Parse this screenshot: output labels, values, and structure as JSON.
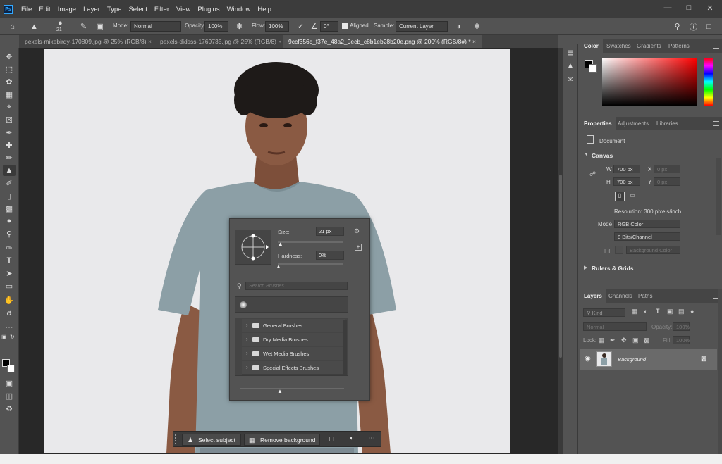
{
  "app": {
    "logo": "Ps"
  },
  "menu": [
    "File",
    "Edit",
    "Image",
    "Layer",
    "Type",
    "Select",
    "Filter",
    "View",
    "Plugins",
    "Window",
    "Help"
  ],
  "options": {
    "brush_size": "21",
    "mode_label": "Mode:",
    "mode_value": "Normal",
    "opacity_label": "Opacity:",
    "opacity_value": "100%",
    "flow_label": "Flow:",
    "flow_value": "100%",
    "angle_value": "0°",
    "aligned_label": "Aligned",
    "sample_label": "Sample:",
    "sample_value": "Current Layer"
  },
  "tabs": [
    {
      "label": "pexels-mikebirdy-170809.jpg @ 25% (RGB/8)"
    },
    {
      "label": "pexels-didsss-1769735.jpg @ 25% (RGB/8)"
    },
    {
      "label": "9ccf356c_f37e_48a2_9ecb_c8b1eb28b20e.png @ 200% (RGB/8#) *"
    }
  ],
  "brush_panel": {
    "size_label": "Size:",
    "size_value": "21 px",
    "size_fraction": 0.03,
    "hardness_label": "Hardness:",
    "hardness_value": "0%",
    "hardness_fraction": 0.0,
    "search_placeholder": "Search Brushes",
    "folders": [
      "General Brushes",
      "Dry Media Brushes",
      "Wet Media Brushes",
      "Special Effects Brushes"
    ]
  },
  "color_panel": {
    "tabs": [
      "Color",
      "Swatches",
      "Gradients",
      "Patterns"
    ],
    "hue_color": "#ff0000"
  },
  "properties_panel": {
    "tabs": [
      "Properties",
      "Adjustments",
      "Libraries"
    ],
    "doc_label": "Document",
    "canvas_title": "Canvas",
    "w_label": "W",
    "w_value": "700 px",
    "h_label": "H",
    "h_value": "700 px",
    "x_label": "X",
    "x_value": "0 px",
    "y_label": "Y",
    "y_value": "0 px",
    "resolution": "Resolution: 300 pixels/inch",
    "mode_label": "Mode",
    "mode_value": "RGB Color",
    "depth_value": "8 Bits/Channel",
    "fill_label": "Fill",
    "fill_value": "Background Color",
    "rulers_title": "Rulers & Grids"
  },
  "layers_panel": {
    "tabs": [
      "Layers",
      "Channels",
      "Paths"
    ],
    "kind_placeholder": "Kind",
    "blend_value": "Normal",
    "opacity_label": "Opacity:",
    "opacity_value": "100%",
    "lock_label": "Lock:",
    "fill_label": "Fill:",
    "fill_value": "100%",
    "layer_name": "Background"
  },
  "context_bar": {
    "select_subject": "Select subject",
    "remove_background": "Remove background"
  }
}
